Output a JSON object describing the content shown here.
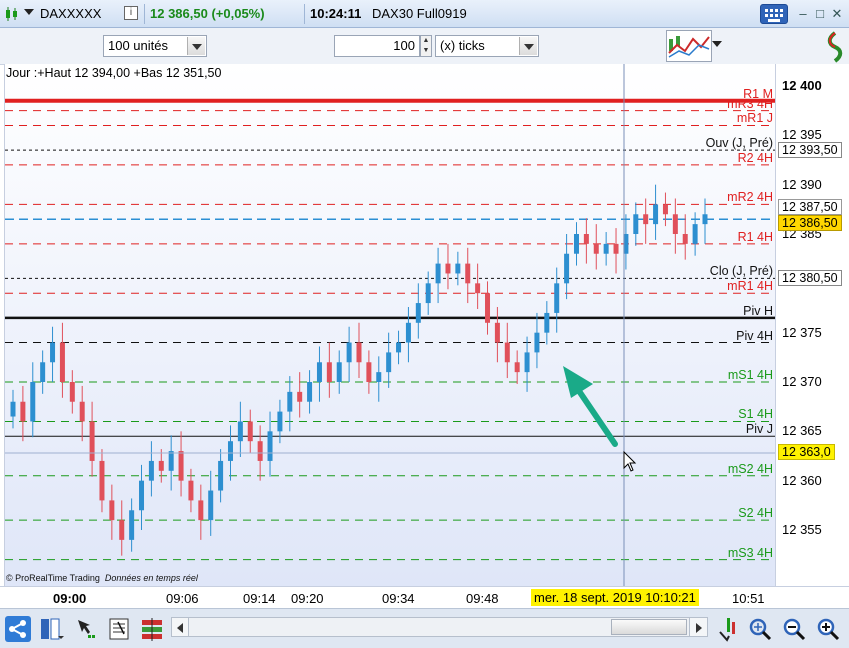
{
  "title_bar": {
    "symbol": "DAXXXXX",
    "last_price": "12 386,50 (+0,05%)",
    "time": "10:24:11",
    "contract": "DAX30 Full0919",
    "info_icon": "info-icon",
    "keyboard_icon": "keyboard-icon",
    "minimize": "–",
    "maximize": "□",
    "close": "✕"
  },
  "toolbar": {
    "units_select": "100 unités",
    "quantity": "100",
    "ticks_select": "(x) ticks"
  },
  "chart": {
    "day_info": "Jour :+Haut 12 394,00 +Bas 12 351,50",
    "credit_brand": "© ProRealTime Trading",
    "credit_text": "Données en temps réel",
    "levels": [
      {
        "label": "R1 M",
        "color": "#e02020"
      },
      {
        "label": "mR3 4H",
        "color": "#e02020"
      },
      {
        "label": "mR1 J",
        "color": "#e02020"
      },
      {
        "label": "Ouv (J, Pré)",
        "color": "#111111"
      },
      {
        "label": "R2 4H",
        "color": "#e02020"
      },
      {
        "label": "mR2 4H",
        "color": "#e02020"
      },
      {
        "label": "R1 4H",
        "color": "#e02020"
      },
      {
        "label": "Clo (J, Pré)",
        "color": "#111111"
      },
      {
        "label": "mR1 4H",
        "color": "#e02020"
      },
      {
        "label": "Piv H",
        "color": "#111111"
      },
      {
        "label": "Piv 4H",
        "color": "#111111"
      },
      {
        "label": "mS1 4H",
        "color": "#1a9a1a"
      },
      {
        "label": "S1 4H",
        "color": "#1a9a1a"
      },
      {
        "label": "Piv J",
        "color": "#111111"
      },
      {
        "label": "mS2 4H",
        "color": "#1a9a1a"
      },
      {
        "label": "S2 4H",
        "color": "#1a9a1a"
      },
      {
        "label": "mS3 4H",
        "color": "#1a9a1a"
      }
    ],
    "price_ticks": [
      "12 400",
      "12 395",
      "12 390",
      "12 385",
      "12 375",
      "12 370",
      "12 365",
      "12 360",
      "12 355"
    ],
    "price_tags": {
      "open_prev": "12 393,50",
      "high_recent": "12 387,50",
      "last": "12 386,50",
      "close_prev": "12 380,50",
      "cursor": "12 363,0"
    },
    "time_labels": [
      "09:00",
      "09:06",
      "09:14",
      "09:20",
      "09:34",
      "09:48",
      "10:51"
    ],
    "cursor_time": "mer. 18 sept. 2019 10:10:21",
    "colors": {
      "up": "#2d8fd0",
      "down": "#e0505a",
      "arrow": "#1aaa88",
      "cursor_tag": "#fff200",
      "last_tag": "#ffd700"
    }
  },
  "chart_data": {
    "type": "candlestick",
    "ylim": [
      12350,
      12403
    ],
    "levels_values": {
      "R1 M": 12398.5,
      "mR3 4H": 12397.5,
      "mR1 J": 12396.0,
      "Ouv (J, Pré)": 12393.5,
      "R2 4H": 12392.0,
      "mR2 4H": 12388.0,
      "R1 4H": 12384.0,
      "Clo (J, Pré)": 12380.5,
      "mR1 4H": 12379.0,
      "Piv H": 12376.5,
      "Piv 4H": 12374.0,
      "mS1 4H": 12370.0,
      "S1 4H": 12366.0,
      "Piv J": 12364.5,
      "mS2 4H": 12360.5,
      "S2 4H": 12356.0,
      "mS3 4H": 12352.0
    },
    "last_price": 12386.5,
    "cursor_price": 12363.0,
    "day_high": 12394.0,
    "day_low": 12351.5
  }
}
